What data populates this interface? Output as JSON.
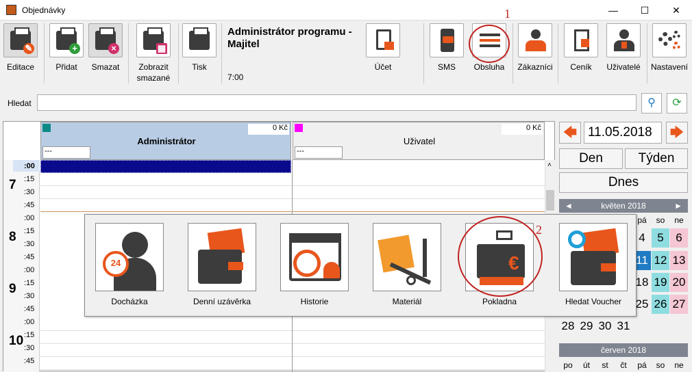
{
  "window": {
    "title": "Objednávky",
    "min": "—",
    "max": "☐",
    "close": "✕"
  },
  "toolbar": {
    "items": [
      {
        "label": "Editace",
        "icon": "edit-icon"
      },
      {
        "label": "Přidat",
        "icon": "add-icon"
      },
      {
        "label": "Smazat",
        "icon": "delete-icon"
      },
      {
        "label": "Zobrazit smazané",
        "icon": "show-deleted-icon"
      },
      {
        "label": "Tisk",
        "icon": "print-icon"
      },
      {
        "label": "Účet",
        "icon": "account-icon"
      },
      {
        "label": "SMS",
        "icon": "sms-icon"
      },
      {
        "label": "Obsluha",
        "icon": "menu-icon"
      },
      {
        "label": "Zákazníci",
        "icon": "customers-icon"
      },
      {
        "label": "Ceník",
        "icon": "pricelist-icon"
      },
      {
        "label": "Uživatelé",
        "icon": "users-icon"
      },
      {
        "label": "Nastavení",
        "icon": "settings-icon"
      }
    ],
    "user_title": "Administrátor programu - Majitel",
    "time": "7:00"
  },
  "search": {
    "label": "Hledat",
    "value": ""
  },
  "columns": [
    {
      "name": "Administrátor",
      "amount": "0 Kč",
      "field": "---",
      "color": "#0e8a87"
    },
    {
      "name": "Uživatel",
      "amount": "0 Kč",
      "field": "---",
      "color": "#ff00ff"
    }
  ],
  "timeline": {
    "hours": [
      "7",
      "8",
      "9",
      "10"
    ],
    "minutes": [
      ":00",
      ":15",
      ":30",
      ":45"
    ]
  },
  "calendar": {
    "date": "11.05.2018",
    "den": "Den",
    "tyden": "Týden",
    "dnes": "Dnes",
    "month1": "květen 2018",
    "month2": "červen 2018",
    "weekday_heads": [
      "pá",
      "so",
      "ne"
    ],
    "weekdays2": [
      "po",
      "út",
      "st",
      "čt",
      "pá",
      "so",
      "ne"
    ],
    "rows": [
      [
        "4",
        "5",
        "6"
      ],
      [
        "11",
        "12",
        "13"
      ],
      [
        "18",
        "19",
        "20"
      ],
      [
        "25",
        "26",
        "27"
      ]
    ],
    "last_row": [
      "28",
      "29",
      "30",
      "31"
    ]
  },
  "popup": {
    "items": [
      {
        "label": "Docházka",
        "icon": "attendance-icon",
        "badge": "24"
      },
      {
        "label": "Denní uzávěrka",
        "icon": "daily-closing-icon"
      },
      {
        "label": "Historie",
        "icon": "history-icon"
      },
      {
        "label": "Materiál",
        "icon": "material-icon"
      },
      {
        "label": "Pokladna",
        "icon": "cash-register-icon"
      },
      {
        "label": "Hledat Voucher",
        "icon": "voucher-search-icon"
      }
    ]
  },
  "annotations": {
    "one": "1",
    "two": "2"
  },
  "colors": {
    "accent": "#e8561c",
    "selected_row": "#0a0a8c",
    "header_blue": "#b8cce4",
    "annotation": "#c0221f"
  }
}
